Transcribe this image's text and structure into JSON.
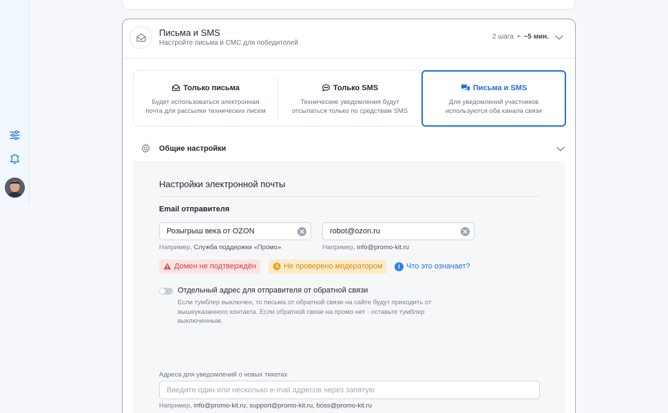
{
  "section": {
    "title": "Письма и SMS",
    "subtitle": "Настройте письма и СМС для победителей",
    "steps": "2 шага",
    "separator": "•",
    "duration": "~5 мин."
  },
  "modes": [
    {
      "title": "Только письма",
      "desc1": "Будет использоваться электронная",
      "desc2": "почта для рассылки технических писем",
      "icon": "envelope-icon"
    },
    {
      "title": "Только SMS",
      "desc1": "Технические уведомления будут",
      "desc2": "отсылаться только по средствам SMS",
      "icon": "chat-bubble-icon"
    },
    {
      "title": "Письма и SMS",
      "desc1": "Для уведомлений участников",
      "desc2": "используются оба канала связи",
      "icon": "chat-bubbles-icon",
      "active": true
    }
  ],
  "general": {
    "label": "Общие настройки"
  },
  "email": {
    "title": "Настройки электронной почты",
    "sender_label": "Email отправителя",
    "name_value": "Розыгрыш века от OZON",
    "address_value": "robot@ozon.ru",
    "name_hint_prefix": "Например, ",
    "name_hint_value": "Служба поддержки «Промо»",
    "address_hint_prefix": "Например, ",
    "address_hint_value": "info@promo-kit.ru",
    "badge_error": "Домен не подтверждён",
    "badge_warning": "Не проверено модератором",
    "info_icon": "i",
    "info_link": "Что это означает?",
    "toggle_label": "Отдельный адрес для отправителя от обратной связи",
    "toggle_desc": "Если тумблер выключен, то письма от обратной связи на сайте будут приходить от вышеуказанного контакта. Если обратной связи на промо нет - оставьте тумблер выключенным.",
    "toggle_on": false
  },
  "tickets": {
    "label": "Адреса для уведомлений о новых тикетах",
    "placeholder": "Введите один или несколько e-mail адресов через запятую",
    "hint_prefix": "Например, ",
    "hint_value": "info@promo-kit.ru, support@promo-kit.ru, boss@promo-kit.ru"
  },
  "colors": {
    "accent": "#1d6fdc",
    "error": "#d43c3c",
    "warning": "#d88a10"
  }
}
